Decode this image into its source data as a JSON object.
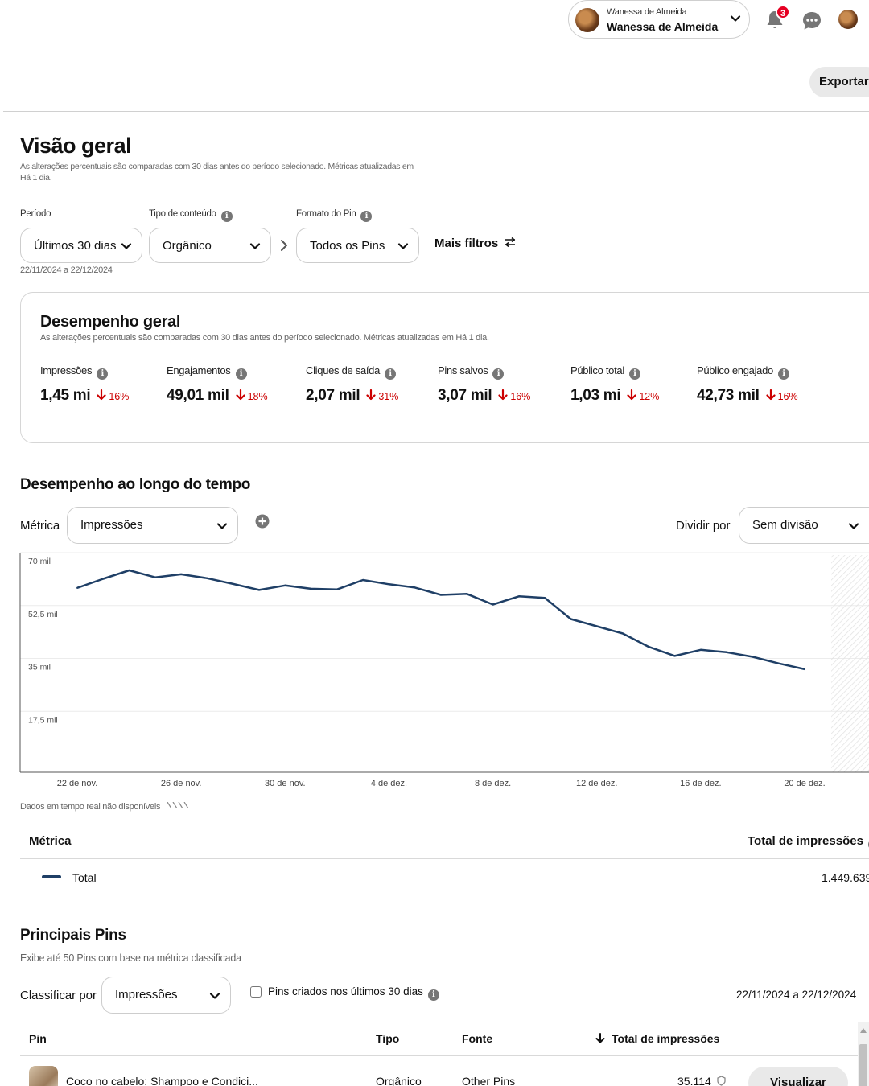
{
  "header": {
    "account_small": "Wanessa de Almeida",
    "account_name": "Wanessa de Almeida",
    "notification_count": "3",
    "export_label": "Exportar"
  },
  "overview": {
    "title": "Visão geral",
    "note": "As alterações percentuais são comparadas com 30 dias antes do período selecionado. Métricas atualizadas em Há 1 dia.",
    "filters": {
      "period_label": "Período",
      "period_value": "Últimos 30 dias",
      "period_range": "22/11/2024 a 22/12/2024",
      "content_type_label": "Tipo de conteúdo",
      "content_type_value": "Orgânico",
      "pin_format_label": "Formato do Pin",
      "pin_format_value": "Todos os Pins",
      "more_filters": "Mais filtros"
    }
  },
  "performance": {
    "title": "Desempenho geral",
    "note": "As alterações percentuais são comparadas com 30 dias antes do período selecionado. Métricas atualizadas em Há 1 dia.",
    "metrics": [
      {
        "label": "Impressões",
        "value": "1,45 mi",
        "change": "16%"
      },
      {
        "label": "Engajamentos",
        "value": "49,01 mil",
        "change": "18%"
      },
      {
        "label": "Cliques de saída",
        "value": "2,07 mil",
        "change": "31%"
      },
      {
        "label": "Pins salvos",
        "value": "3,07 mil",
        "change": "16%"
      },
      {
        "label": "Público total",
        "value": "1,03 mi",
        "change": "12%"
      },
      {
        "label": "Público engajado",
        "value": "42,73 mil",
        "change": "16%"
      }
    ],
    "decrease_color": "#cc0000"
  },
  "over_time": {
    "title": "Desempenho ao longo do tempo",
    "metric_label": "Métrica",
    "metric_value": "Impressões",
    "split_label": "Dividir por",
    "split_value": "Sem divisão",
    "realtime_note": "Dados em tempo real não disponíveis",
    "table_metric_header": "Métrica",
    "table_total_header": "Total de impressões",
    "table_row_label": "Total",
    "table_row_value": "1.449.639",
    "line_color": "#1f3f66"
  },
  "chart_data": {
    "type": "line",
    "x": [
      "22/11",
      "23/11",
      "24/11",
      "25/11",
      "26/11",
      "27/11",
      "28/11",
      "29/11",
      "30/11",
      "01/12",
      "02/12",
      "03/12",
      "04/12",
      "05/12",
      "06/12",
      "07/12",
      "08/12",
      "09/12",
      "10/12",
      "11/12",
      "12/12",
      "13/12",
      "14/12",
      "15/12",
      "16/12",
      "17/12",
      "18/12",
      "19/12",
      "20/12"
    ],
    "series": [
      {
        "values": [
          61000,
          64000,
          66800,
          64500,
          65500,
          64200,
          62300,
          60300,
          61800,
          60700,
          60500,
          63600,
          62200,
          61100,
          58700,
          59000,
          55500,
          58200,
          57700,
          50700,
          48300,
          45900,
          41500,
          38500,
          40500,
          39700,
          38200,
          36000,
          34100
        ]
      }
    ],
    "x_tick_labels": [
      "22 de nov.",
      "26 de nov.",
      "30 de nov.",
      "4 de dez.",
      "8 de dez.",
      "12 de dez.",
      "16 de dez.",
      "20 de dez."
    ],
    "y_tick_labels": [
      "70 mil",
      "52,5 mil",
      "35 mil",
      "17,5 mil"
    ],
    "y_ticks": [
      70000,
      52500,
      35000,
      17500
    ],
    "ylim": [
      0,
      70000
    ],
    "grid": true
  },
  "top_pins": {
    "title": "Principais Pins",
    "note": "Exibe até 50 Pins com base na métrica classificada",
    "sort_label": "Classificar por",
    "sort_value": "Impressões",
    "checkbox_label": "Pins criados nos últimos 30 dias",
    "date_range": "22/11/2024 a 22/12/2024",
    "columns": [
      "Pin",
      "Tipo",
      "Fonte",
      "Total de impressões"
    ],
    "rows": [
      {
        "pin": "Coco no cabelo: Shampoo e Condici...",
        "type": "Orgânico",
        "source": "Other Pins",
        "impressions": "35.114",
        "action": "Visualizar"
      }
    ]
  }
}
